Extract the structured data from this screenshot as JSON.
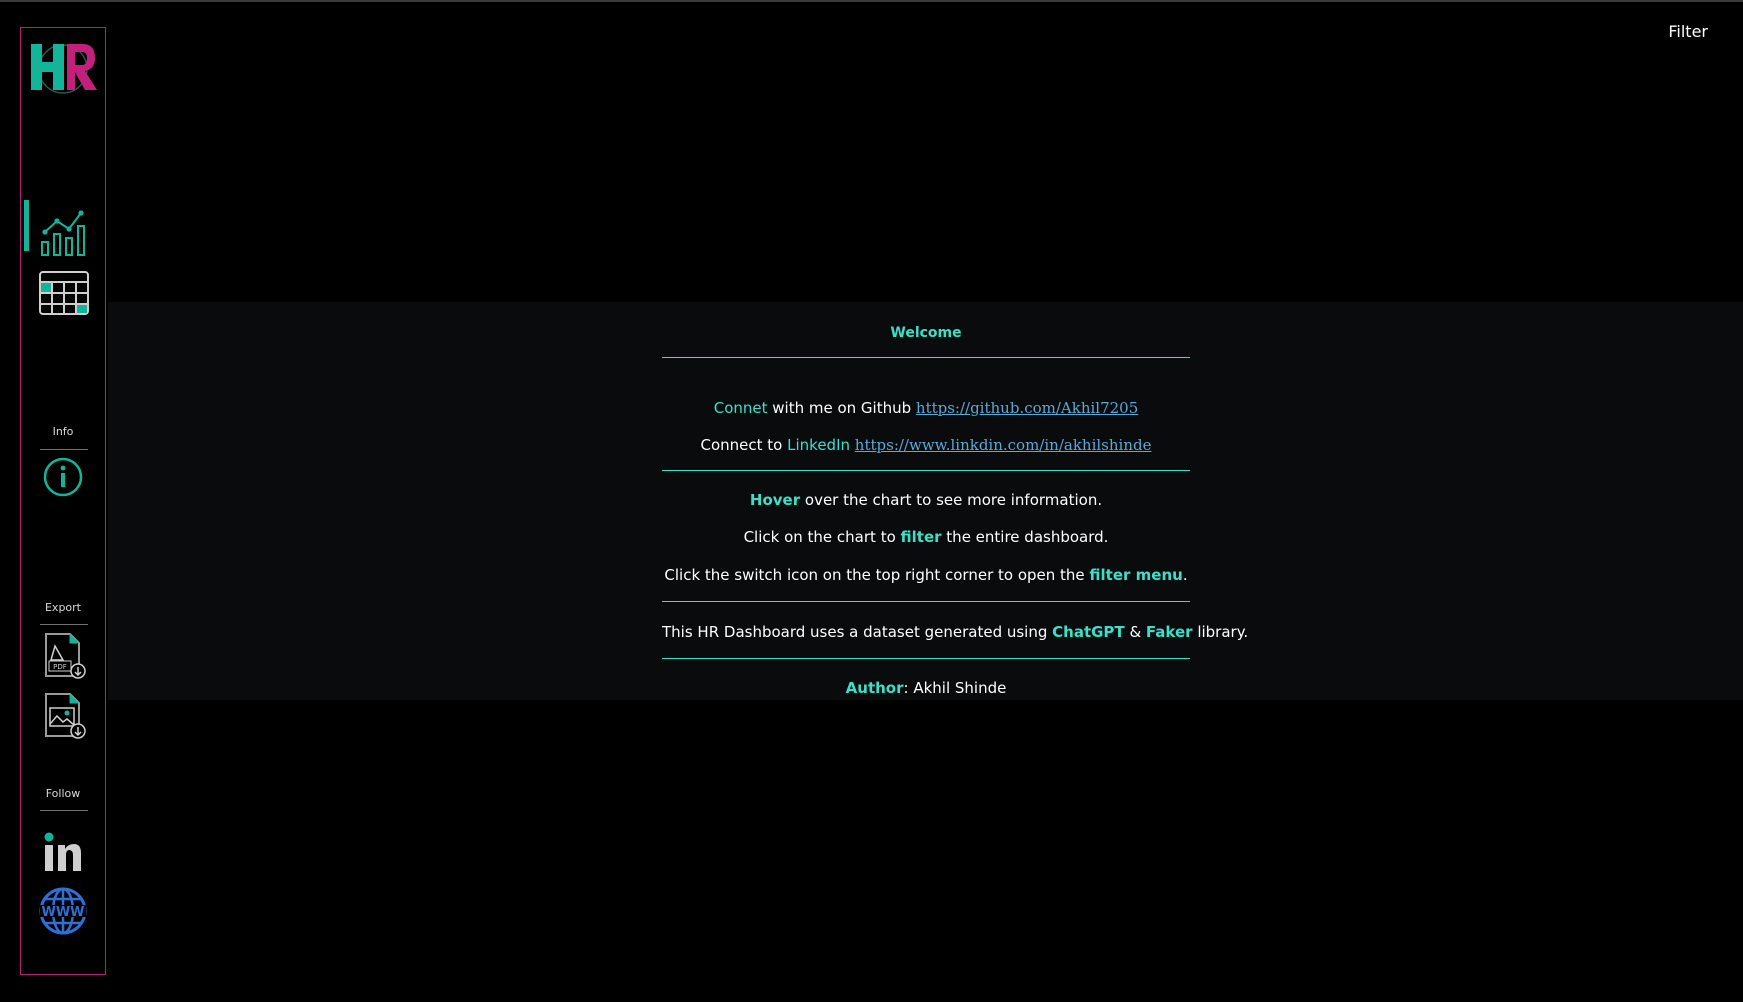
{
  "header": {
    "filter_label": "Filter"
  },
  "sidebar": {
    "logo_text": "HR",
    "nav": [
      {
        "icon": "chart-icon"
      },
      {
        "icon": "table-icon"
      }
    ],
    "info_label": "Info",
    "export_label": "Export",
    "export_pdf_text": "PDF",
    "follow_label": "Follow",
    "linkedin_text": "in",
    "website_text": "WWW"
  },
  "welcome": {
    "title": "Welcome",
    "github_prefix_hl": "Connet",
    "github_text": " with me on Github ",
    "github_url": "https://github.com/Akhil7205",
    "linkedin_prefix": "Connect to ",
    "linkedin_hl": "LinkedIn",
    "linkedin_url": "https://www.linkdin.com/in/akhilshinde",
    "hover_hl": "Hover",
    "hover_text": " over the chart to see more information.",
    "click_prefix": "Click on the chart to ",
    "click_hl": "filter",
    "click_suffix": " the entire dashboard.",
    "switch_prefix": "Click the switch icon on the top right corner to open the ",
    "switch_hl": "filter menu",
    "switch_suffix": ".",
    "dataset_prefix": "This HR Dashboard uses a dataset generated using ",
    "dataset_hl1": "ChatGPT",
    "dataset_amp": " & ",
    "dataset_hl2": "Faker",
    "dataset_suffix": " library.",
    "author_hl": "Author",
    "author_text": ": Akhil Shinde"
  },
  "colors": {
    "accent": "#3ddfc8",
    "logo_teal": "#13b59a",
    "logo_magenta": "#c2207a",
    "sidebar_border": "#b0246e",
    "link": "#5aa9d6",
    "panel_bg": "#090b0d"
  }
}
